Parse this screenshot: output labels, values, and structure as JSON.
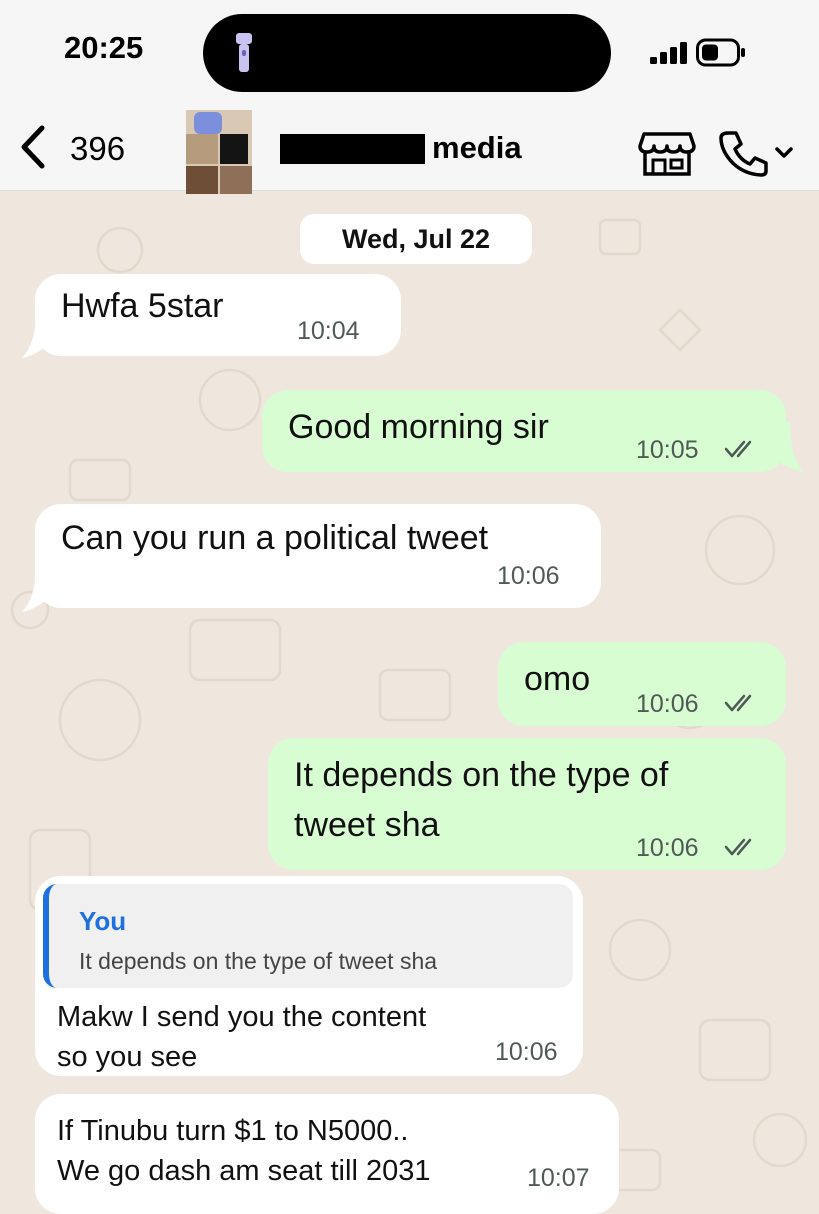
{
  "status_bar": {
    "time": "20:25"
  },
  "header": {
    "unread_count": "396",
    "contact_name_visible": "media"
  },
  "chat": {
    "date_label": "Wed, Jul 22",
    "messages": [
      {
        "direction": "incoming",
        "text": "Hwfa 5star",
        "time": "10:04"
      },
      {
        "direction": "outgoing",
        "text": "Good morning sir",
        "time": "10:05",
        "status": "read"
      },
      {
        "direction": "incoming",
        "text": "Can you run a political tweet",
        "time": "10:06"
      },
      {
        "direction": "outgoing",
        "text": "omo",
        "time": "10:06",
        "status": "read"
      },
      {
        "direction": "outgoing",
        "lines": [
          "It depends on the type of",
          "tweet sha"
        ],
        "time": "10:06",
        "status": "read"
      },
      {
        "direction": "incoming",
        "quote": {
          "author": "You",
          "text": "It depends on the type of tweet sha"
        },
        "lines": [
          "Makw I send you the content",
          "so you see"
        ],
        "time": "10:06"
      },
      {
        "direction": "incoming",
        "lines": [
          "If Tinubu turn $1 to N5000..",
          "We go dash am seat till 2031"
        ],
        "time": "10:07"
      }
    ]
  },
  "colors": {
    "incoming_bubble": "#ffffff",
    "outgoing_bubble": "#d9fdd3",
    "chat_background": "#efe7de",
    "quote_accent": "#1e6fe0"
  },
  "icons": [
    "flashlight-icon",
    "signal-icon",
    "battery-icon",
    "back-chevron-icon",
    "shop-icon",
    "phone-icon",
    "chevron-down-icon",
    "double-check-icon"
  ]
}
